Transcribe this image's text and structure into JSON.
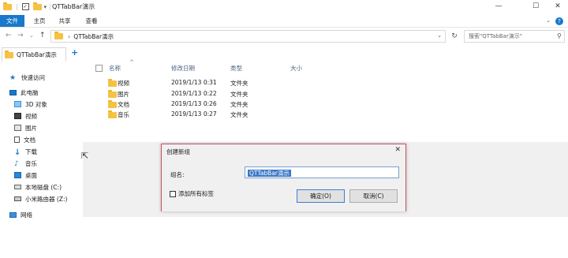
{
  "window": {
    "title": "QTTabBar演示",
    "minimize": "—",
    "maximize": "☐",
    "close": "✕"
  },
  "ribbon": {
    "tabs": [
      "文件",
      "主页",
      "共享",
      "查看"
    ],
    "help": "?"
  },
  "nav": {
    "back": "←",
    "forward": "→",
    "recent": "⌄",
    "up": "↑",
    "address_sep": "›",
    "address": "QTTabBar演示",
    "refresh": "↻",
    "search_placeholder": "搜索\"QTTabBar演示\""
  },
  "tabs": {
    "items": [
      {
        "label": "QTTabBar演示"
      }
    ],
    "add": "+"
  },
  "sidebar": {
    "items": [
      {
        "label": "快速访问",
        "icon": "star-icon",
        "color": "#1979ca"
      },
      {
        "label": "此电脑",
        "icon": "computer-icon",
        "color": "#1979ca"
      },
      {
        "label": "3D 对象",
        "icon": "cube-icon",
        "color": "#59a7e6"
      },
      {
        "label": "视频",
        "icon": "video-icon",
        "color": "#555"
      },
      {
        "label": "图片",
        "icon": "picture-icon",
        "color": "#555"
      },
      {
        "label": "文档",
        "icon": "document-icon",
        "color": "#555"
      },
      {
        "label": "下载",
        "icon": "download-icon",
        "color": "#1979ca"
      },
      {
        "label": "音乐",
        "icon": "music-icon",
        "color": "#1979ca"
      },
      {
        "label": "桌面",
        "icon": "desktop-icon",
        "color": "#1979ca"
      },
      {
        "label": "本地磁盘 (C:)",
        "icon": "drive-icon",
        "color": "#555"
      },
      {
        "label": "小米路由器 (Z:)",
        "icon": "network-drive-icon",
        "color": "#555"
      },
      {
        "label": "网络",
        "icon": "network-icon",
        "color": "#1979ca"
      }
    ]
  },
  "columns": {
    "name": "名称",
    "modified": "修改日期",
    "type": "类型",
    "size": "大小"
  },
  "files": [
    {
      "name": "视频",
      "modified": "2019/1/13 0:31",
      "type": "文件夹"
    },
    {
      "name": "图片",
      "modified": "2019/1/13 0:22",
      "type": "文件夹"
    },
    {
      "name": "文档",
      "modified": "2019/1/13 0:26",
      "type": "文件夹"
    },
    {
      "name": "音乐",
      "modified": "2019/1/13 0:27",
      "type": "文件夹"
    }
  ],
  "dialog": {
    "title": "创建新组",
    "close": "✕",
    "name_label": "组名:",
    "name_value": "QTTabBar演示",
    "checkbox_label": "添加所有标签",
    "ok": "确定(O)",
    "cancel": "取消(C)"
  }
}
